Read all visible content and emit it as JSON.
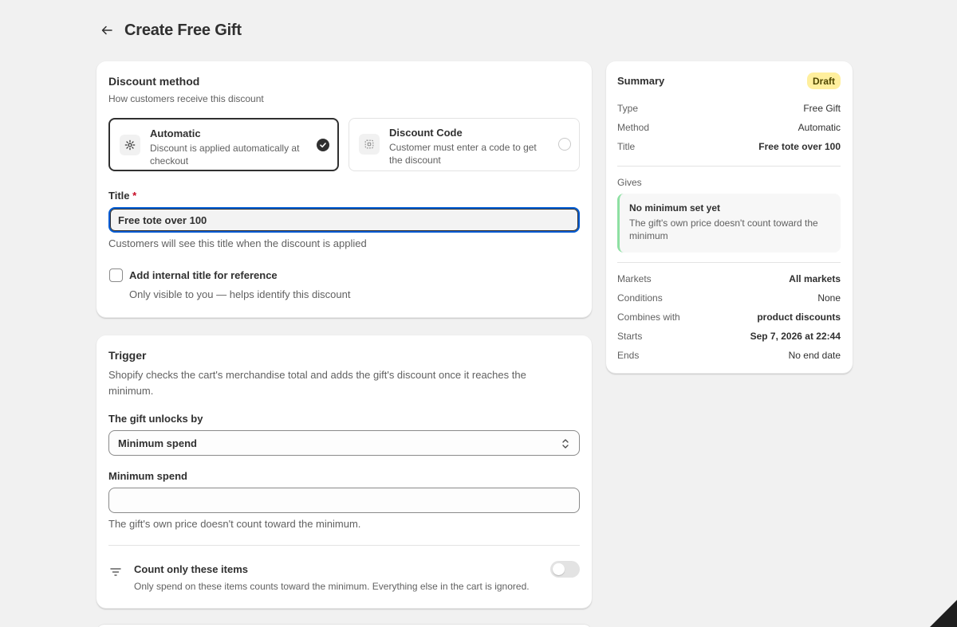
{
  "header": {
    "title": "Create Free Gift"
  },
  "method": {
    "title": "Discount method",
    "subtitle": "How customers receive this discount",
    "options": [
      {
        "title": "Automatic",
        "desc": "Discount is applied automatically at checkout",
        "selected": true
      },
      {
        "title": "Discount Code",
        "desc": "Customer must enter a code to get the discount",
        "selected": false
      }
    ],
    "title_label": "Title",
    "required_mark": "*",
    "title_value": "Free tote over 100",
    "title_help": "Customers will see this title when the discount is applied",
    "internal_label": "Add internal title for reference",
    "internal_help": "Only visible to you — helps identify this discount"
  },
  "trigger": {
    "title": "Trigger",
    "desc": "Shopify checks the cart's merchandise total and adds the gift's discount once it reaches the minimum.",
    "unlock_label": "The gift unlocks by",
    "unlock_value": "Minimum spend",
    "spend_label": "Minimum spend",
    "spend_value": "",
    "spend_help": "The gift's own price doesn't count toward the minimum.",
    "count_title": "Count only these items",
    "count_help": "Only spend on these items counts toward the minimum. Everything else in the cart is ignored.",
    "count_enabled": false
  },
  "summary": {
    "title": "Summary",
    "badge": "Draft",
    "rows_top": [
      {
        "k": "Type",
        "v": "Free Gift"
      },
      {
        "k": "Method",
        "v": "Automatic"
      },
      {
        "k": "Title",
        "v": "Free tote over 100"
      }
    ],
    "gives_label": "Gives",
    "gives_title": "No minimum set yet",
    "gives_desc": "The gift's own price doesn't count toward the minimum",
    "rows_bottom": [
      {
        "k": "Markets",
        "v": "All markets"
      },
      {
        "k": "Conditions",
        "v": "None"
      },
      {
        "k": "Combines with",
        "v": "product discounts"
      },
      {
        "k": "Starts",
        "v": "Sep 7, 2026 at 22:44"
      },
      {
        "k": "Ends",
        "v": "No end date"
      }
    ]
  },
  "colors": {
    "accent_focus": "#005bd3",
    "badge_bg": "#ffef9d",
    "gives_border": "#8ee0a3"
  },
  "icons": [
    "arrow-left-icon",
    "gear-icon",
    "code-icon",
    "check-icon",
    "select-arrows-icon",
    "filter-icon"
  ]
}
